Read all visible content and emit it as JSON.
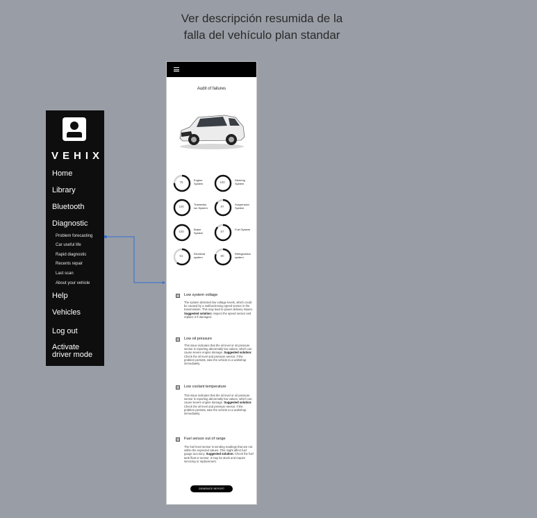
{
  "caption": "Ver descripción resumida de la falla del vehículo plan standar",
  "sidebar": {
    "brand": "VEHIX",
    "items": [
      "Home",
      "Library",
      "Bluetooth",
      "Diagnostic"
    ],
    "sub_items": [
      "Problem forecasting",
      "Car useful life",
      "Rapid diagnostic",
      "Recents repair",
      "Last scan",
      "About your vehicle"
    ],
    "bottom_items": [
      "Help",
      "Vehicles",
      "Log out"
    ],
    "activate_line1": "Activate",
    "activate_line2": "driver mode"
  },
  "phone": {
    "title": "Audit of failures",
    "gauges": [
      {
        "value": 75,
        "label1": "Engine",
        "label2": "System"
      },
      {
        "value": 100,
        "label1": "Steering",
        "label2": "System"
      },
      {
        "value": 100,
        "label1": "Transmiss",
        "label2": "ion System"
      },
      {
        "value": 87,
        "label1": "Suspension",
        "label2": "System"
      },
      {
        "value": 100,
        "label1": "Brake",
        "label2": "System"
      },
      {
        "value": 87,
        "label1": "Fuel System",
        "label2": ""
      },
      {
        "value": 61,
        "label1": "Electrical",
        "label2": "system"
      },
      {
        "value": 80,
        "label1": "Refrigeration",
        "label2": "system"
      }
    ],
    "issues": [
      {
        "title": "Low system voltage",
        "desc": "The system detected low voltage levels, which could be caused by a malfunctioning speed sensor in the transmission. This may lead to power delivery issues.",
        "solution_label": "Suggested solution:",
        "solution": "Inspect the speed sensor and replace it if damaged."
      },
      {
        "title": "Low oil pressure",
        "desc": "This issue indicates that the oil level or oil pressure sensor is reporting abnormally low values, which can cause severe engine damage.",
        "solution_label": "Suggested solution:",
        "solution": "Check the oil level and pressure sensor. If the problem persists, take the vehicle to a workshop immediately."
      },
      {
        "title": "Low coolant temperature",
        "desc": "This issue indicates that the oil level or oil pressure sensor is reporting abnormally low values, which can cause severe engine damage.",
        "solution_label": "Suggested solution:",
        "solution": "Check the oil level and pressure sensor. If the problem persists, take the vehicle to a workshop immediately."
      },
      {
        "title": "Fuel sensor out of range",
        "desc": "The fuel level sensor is sending readings that are not within the expected values. This might affect fuel gauge accuracy.",
        "solution_label": "Suggested solution:",
        "solution": "Check the fuel tank float or sensor. It may be stuck and require servicing or replacement."
      }
    ],
    "report_button": "GENERATE REPORT"
  },
  "colors": {
    "background": "#999ea6",
    "sidebar": "#0e0e0e",
    "connector": "#2f6fd6"
  }
}
